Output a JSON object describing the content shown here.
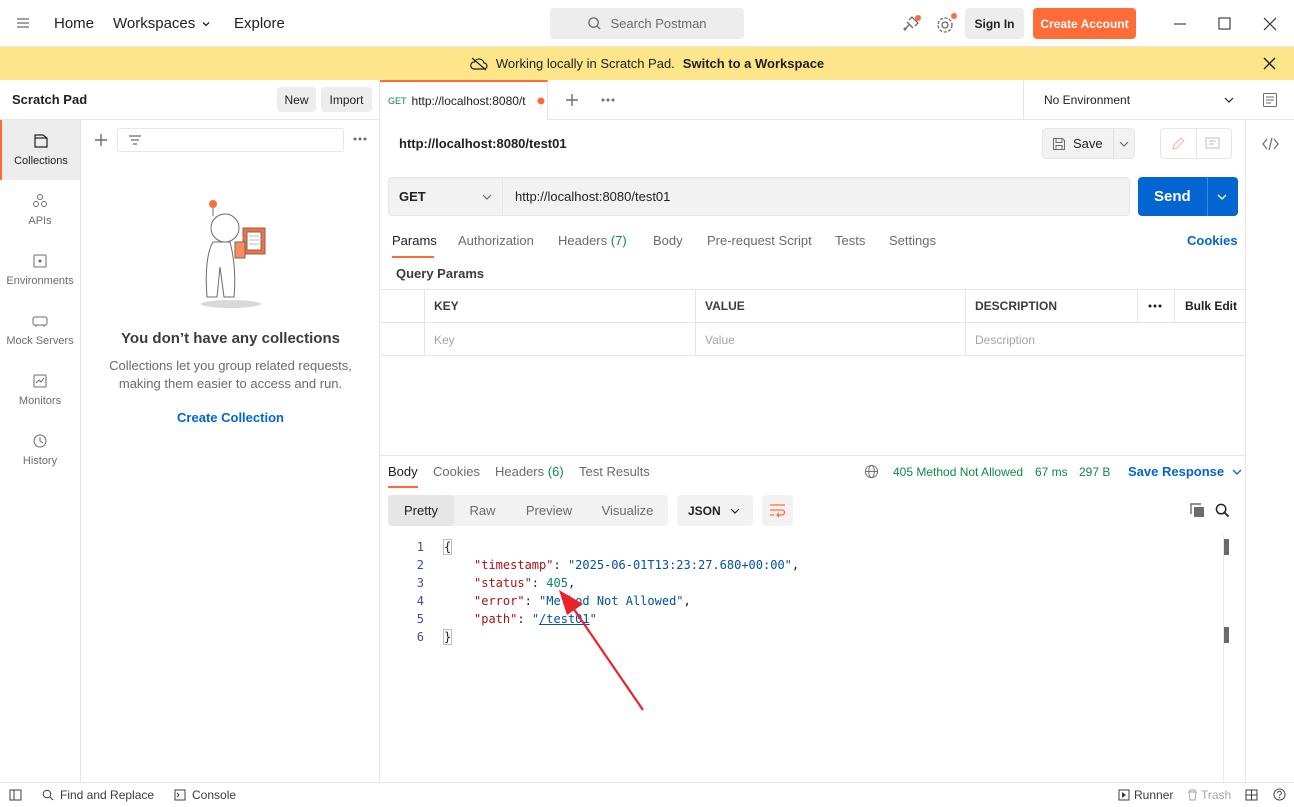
{
  "header": {
    "home": "Home",
    "workspaces": "Workspaces",
    "explore": "Explore",
    "search_placeholder": "Search Postman",
    "sign_in": "Sign In",
    "create_account": "Create Account"
  },
  "banner": {
    "text": "Working locally in Scratch Pad.",
    "link": "Switch to a Workspace"
  },
  "left": {
    "title": "Scratch Pad",
    "new_btn": "New",
    "import_btn": "Import",
    "sidebar": [
      {
        "label": "Collections",
        "icon": "collections-icon"
      },
      {
        "label": "APIs",
        "icon": "apis-icon"
      },
      {
        "label": "Environments",
        "icon": "environments-icon"
      },
      {
        "label": "Mock Servers",
        "icon": "mock-servers-icon"
      },
      {
        "label": "Monitors",
        "icon": "monitors-icon"
      },
      {
        "label": "History",
        "icon": "history-icon"
      }
    ],
    "empty_title": "You don’t have any collections",
    "empty_desc_1": "Collections let you group related requests,",
    "empty_desc_2": "making them easier to access and run.",
    "create_collection": "Create Collection"
  },
  "tab": {
    "method": "GET",
    "title": "http://localhost:8080/t",
    "environment": "No Environment"
  },
  "request": {
    "name": "http://localhost:8080/test01",
    "save": "Save",
    "method": "GET",
    "url": "http://localhost:8080/test01",
    "send": "Send",
    "tabs": {
      "params": "Params",
      "authorization": "Authorization",
      "headers": "Headers",
      "headers_count": "(7)",
      "body": "Body",
      "prerequest": "Pre-request Script",
      "tests": "Tests",
      "settings": "Settings"
    },
    "cookies": "Cookies",
    "query_params": "Query Params",
    "table": {
      "key": "KEY",
      "value": "VALUE",
      "description": "DESCRIPTION",
      "bulk_edit": "Bulk Edit",
      "key_placeholder": "Key",
      "value_placeholder": "Value",
      "description_placeholder": "Description"
    }
  },
  "response": {
    "tabs": {
      "body": "Body",
      "cookies": "Cookies",
      "headers": "Headers",
      "headers_count": "(6)",
      "test_results": "Test Results"
    },
    "status": "405 Method Not Allowed",
    "time": "67 ms",
    "size": "297 B",
    "save_response": "Save Response",
    "view_tabs": [
      "Pretty",
      "Raw",
      "Preview",
      "Visualize"
    ],
    "format": "JSON",
    "code": {
      "line_numbers": [
        "1",
        "2",
        "3",
        "4",
        "5",
        "6"
      ],
      "open": "{",
      "timestamp_key": "\"timestamp\"",
      "timestamp_val": "\"2025-06-01T13:23:27.680+00:00\"",
      "status_key": "\"status\"",
      "status_val": "405",
      "error_key": "\"error\"",
      "error_val": "\"Method Not Allowed\"",
      "path_key": "\"path\"",
      "path_val": "/test01",
      "close": "}"
    }
  },
  "footer": {
    "find_replace": "Find and Replace",
    "console": "Console",
    "runner": "Runner",
    "trash": "Trash"
  },
  "colors": {
    "accent": "#ff6c37",
    "primary": "#0265d2",
    "banner": "#fde68a",
    "status_error": "#0c8a4a"
  }
}
